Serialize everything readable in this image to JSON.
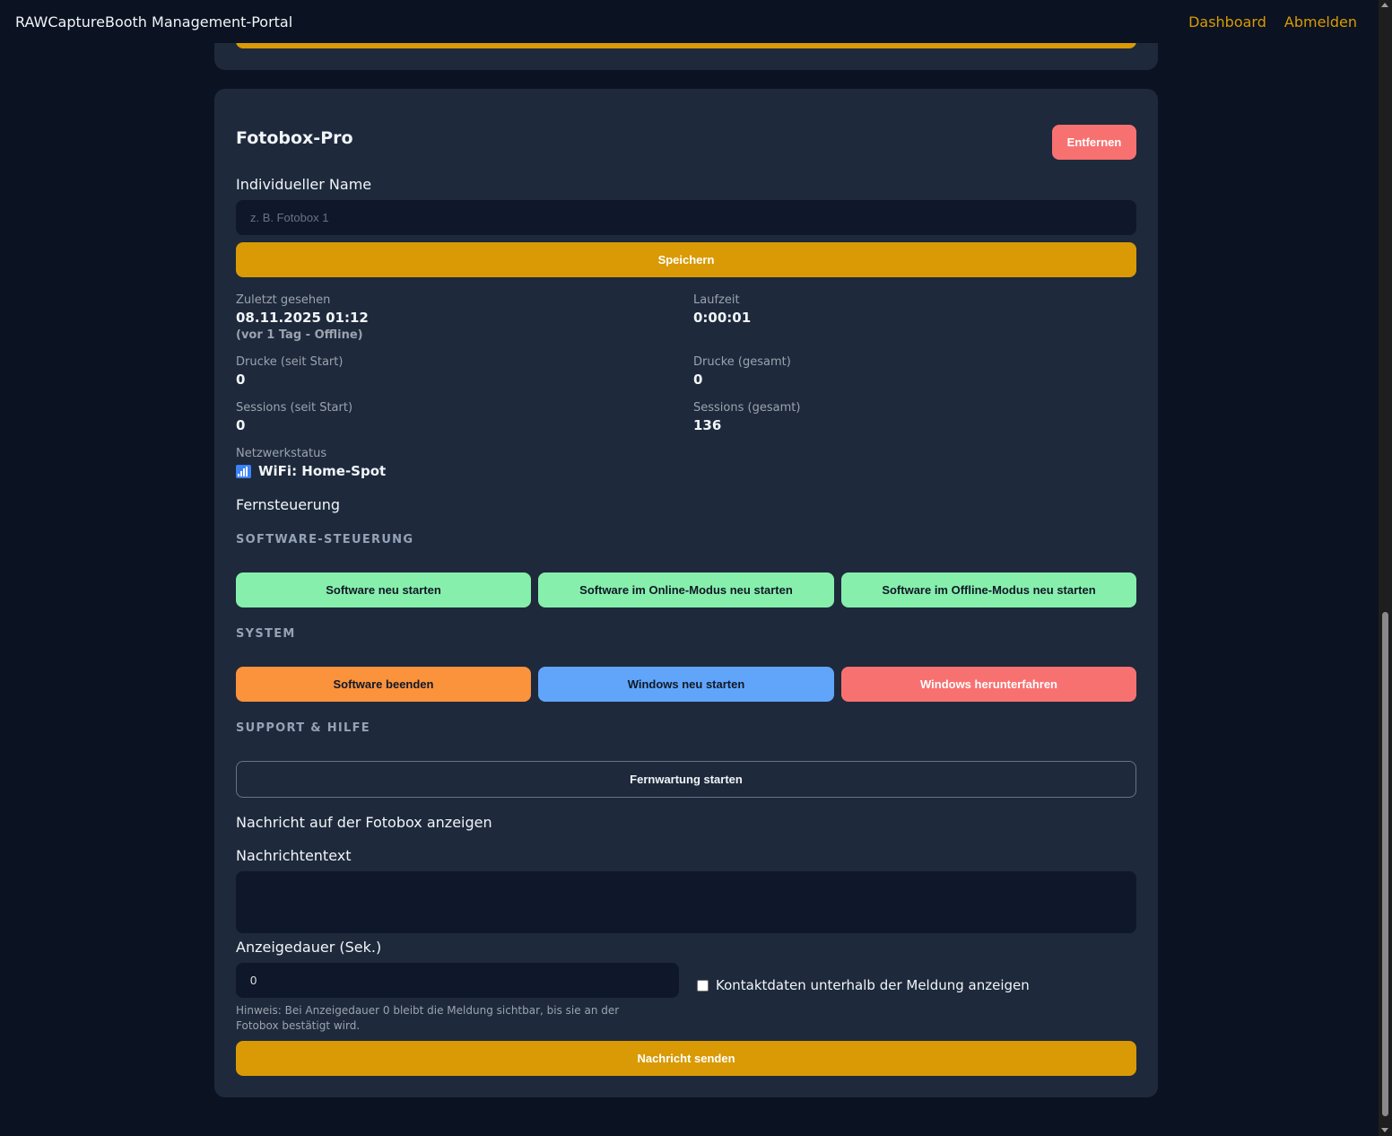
{
  "header": {
    "brand": "RAWCaptureBooth Management-Portal",
    "nav": {
      "dashboard": "Dashboard",
      "logout": "Abmelden"
    }
  },
  "device": {
    "title": "Fotobox-Pro",
    "remove_label": "Entfernen",
    "name_label": "Individueller Name",
    "name_placeholder": "z. B. Fotobox 1",
    "save_label": "Speichern",
    "stats": {
      "last_seen_label": "Zuletzt gesehen",
      "last_seen_value": "08.11.2025 01:12",
      "last_seen_sub": "(vor 1 Tag - Offline)",
      "runtime_label": "Laufzeit",
      "runtime_value": "0:00:01",
      "prints_since_label": "Drucke (seit Start)",
      "prints_since_value": "0",
      "prints_total_label": "Drucke (gesamt)",
      "prints_total_value": "0",
      "sessions_since_label": "Sessions (seit Start)",
      "sessions_since_value": "0",
      "sessions_total_label": "Sessions (gesamt)",
      "sessions_total_value": "136",
      "network_label": "Netzwerkstatus",
      "network_value": "WiFi: Home-Spot",
      "network_icon": "wifi-signal-icon"
    },
    "remote_title": "Fernsteuerung",
    "software_section": {
      "heading": "SOFTWARE-STEUERUNG",
      "buttons": [
        "Software neu starten",
        "Software im Online-Modus neu starten",
        "Software im Offline-Modus neu starten"
      ]
    },
    "system_section": {
      "heading": "SYSTEM",
      "buttons": [
        "Software beenden",
        "Windows neu starten",
        "Windows herunterfahren"
      ]
    },
    "support_section": {
      "heading": "SUPPORT & HILFE",
      "remote_maintenance": "Fernwartung starten"
    },
    "message": {
      "title": "Nachricht auf der Fotobox anzeigen",
      "text_label": "Nachrichtentext",
      "text_value": "",
      "duration_label": "Anzeigedauer (Sek.)",
      "duration_value": "0",
      "contact_checkbox_label": "Kontaktdaten unterhalb der Meldung anzeigen",
      "contact_checked": false,
      "hint": "Hinweis: Bei Anzeigedauer 0 bleibt die Meldung sichtbar, bis sie an der Fotobox bestätigt wird.",
      "send_label": "Nachricht senden"
    }
  },
  "colors": {
    "background": "#0b1221",
    "card": "#1e293b",
    "accent": "#d99a06",
    "green": "#86efac",
    "orange": "#fb923c",
    "blue": "#60a5fa",
    "red": "#f87171"
  }
}
